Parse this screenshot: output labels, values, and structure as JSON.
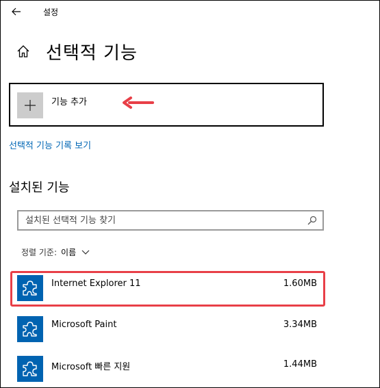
{
  "window": {
    "title": "설정"
  },
  "header": {
    "title": "선택적 기능"
  },
  "add_feature": {
    "label": "기능 추가"
  },
  "history_link": {
    "label": "선택적 기능 기록 보기"
  },
  "installed": {
    "title": "설치된 기능",
    "search_placeholder": "설치된 선택적 기능 찾기",
    "sort_label": "정렬 기준:",
    "sort_value": "이름"
  },
  "features": [
    {
      "name": "Internet Explorer 11",
      "size": "1.60MB",
      "highlighted": true
    },
    {
      "name": "Microsoft Paint",
      "size": "3.34MB",
      "highlighted": false
    },
    {
      "name": "Microsoft 빠른 지원",
      "size": "1.44MB",
      "highlighted": false
    }
  ],
  "colors": {
    "accent": "#0063b1",
    "link": "#0066b4",
    "annotation_red": "#e83f47",
    "add_tile": "#cccccc"
  },
  "icons": {
    "back": "back-arrow-icon",
    "home": "home-icon",
    "add": "plus-icon",
    "search": "search-icon",
    "sort": "chevron-down-icon",
    "feature": "puzzle-icon"
  }
}
